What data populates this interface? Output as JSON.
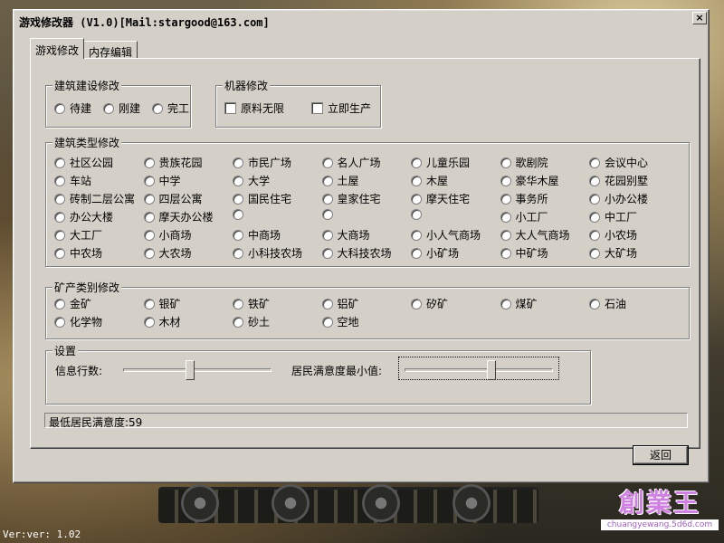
{
  "window": {
    "title": "游戏修改器 (V1.0)[Mail:stargood@163.com]",
    "close_label": "×"
  },
  "tabs": [
    {
      "label": "游戏修改"
    },
    {
      "label": "内存编辑"
    }
  ],
  "building_build": {
    "title": "建筑建设修改",
    "options": [
      "待建",
      "刚建",
      "完工"
    ]
  },
  "machine": {
    "title": "机器修改",
    "options": [
      "原料无限",
      "立即生产"
    ]
  },
  "building_type": {
    "title": "建筑类型修改",
    "options": [
      "社区公园",
      "贵族花园",
      "市民广场",
      "名人广场",
      "儿童乐园",
      "歌剧院",
      "会议中心",
      "车站",
      "中学",
      "大学",
      "土屋",
      "木屋",
      "豪华木屋",
      "花园别墅",
      "砖制二层公寓",
      "四层公寓",
      "国民住宅",
      "皇家住宅",
      "摩天住宅",
      "事务所",
      "小办公楼",
      "办公大楼",
      "摩天办公楼",
      "",
      "",
      "",
      "小工厂",
      "中工厂",
      "大工厂",
      "小商场",
      "中商场",
      "大商场",
      "小人气商场",
      "大人气商场",
      "小农场",
      "中农场",
      "大农场",
      "小科技农场",
      "大科技农场",
      "小矿场",
      "中矿场",
      "大矿场"
    ]
  },
  "mineral": {
    "title": "矿产类别修改",
    "options": [
      "金矿",
      "银矿",
      "铁矿",
      "铝矿",
      "矽矿",
      "煤矿",
      "石油",
      "化学物",
      "木材",
      "砂土",
      "空地"
    ]
  },
  "settings": {
    "title": "设置",
    "info_rows_label": "信息行数:",
    "info_rows_value": 0.45,
    "min_satisfaction_label": "居民满意度最小值:",
    "min_satisfaction_value": 0.59
  },
  "status": {
    "text": "最低居民满意度:59"
  },
  "buttons": {
    "back": "返回"
  },
  "footer": {
    "version": "Ver:ver: 1.02"
  },
  "watermark": {
    "brand": "創業王",
    "url": "chuangyewang.5d6d.com"
  },
  "colors": {
    "dialog_bg": "#d4d0c8",
    "watermark": "#d080e0"
  }
}
